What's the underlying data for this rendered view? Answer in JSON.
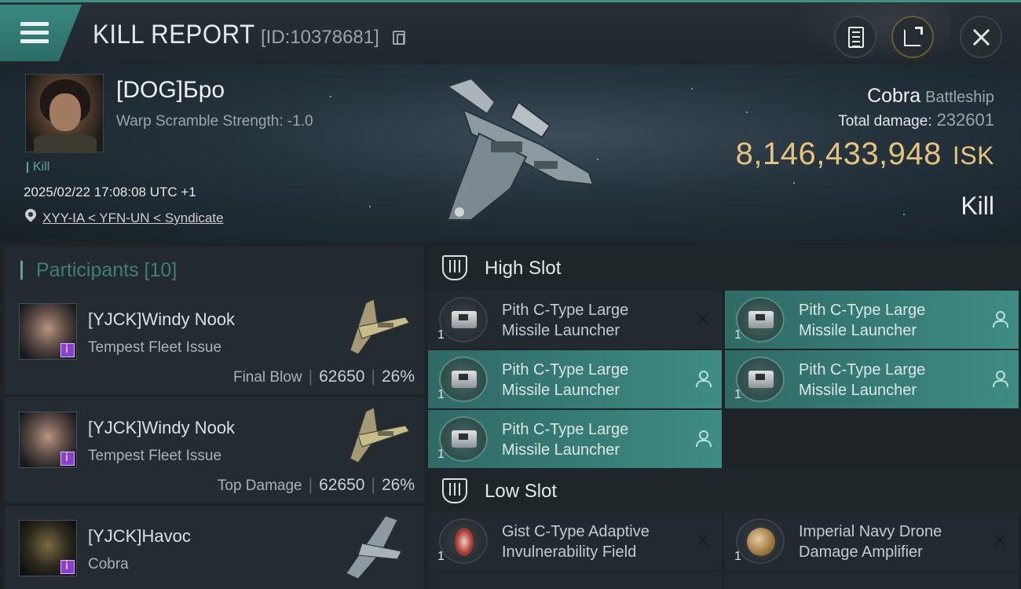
{
  "header": {
    "title": "KILL REPORT",
    "report_id": "[ID:10378681]",
    "icons": [
      "menu-icon",
      "copy-icon",
      "clipboard-icon",
      "share-icon",
      "close-icon"
    ]
  },
  "victim": {
    "name": "[DOG]Бро",
    "warp_scramble": "Warp Scramble Strength: -1.0",
    "kill_tag": "Kill",
    "datetime": "2025/02/22 17:08:08 UTC +1",
    "location": "XYY-IA < YFN-UN < Syndicate",
    "ship_name": "Cobra",
    "ship_class": "Battleship",
    "total_damage_label": "Total damage:",
    "total_damage": "232601",
    "isk_value": "8,146,433,948",
    "isk_unit": "ISK",
    "result": "Kill"
  },
  "participants": {
    "label": "Participants [10]",
    "rows": [
      {
        "name": "[YJCK]Windy Nook",
        "ship": "Tempest Fleet Issue",
        "role": "Final Blow",
        "damage": "62650",
        "percent": "26%"
      },
      {
        "name": "[YJCK]Windy Nook",
        "ship": "Tempest Fleet Issue",
        "role": "Top Damage",
        "damage": "62650",
        "percent": "26%"
      },
      {
        "name": "[YJCK]Havoc",
        "ship": "Cobra",
        "role": "",
        "damage": "",
        "percent": ""
      }
    ]
  },
  "slots": {
    "high": {
      "label": "High Slot",
      "modules": [
        {
          "name_line1": "Pith C-Type Large",
          "name_line2": "Missile Launcher",
          "qty": "1",
          "status": "destroyed"
        },
        {
          "name_line1": "Pith C-Type Large",
          "name_line2": "Missile Launcher",
          "qty": "1",
          "status": "dropped"
        },
        {
          "name_line1": "Pith C-Type Large",
          "name_line2": "Missile Launcher",
          "qty": "1",
          "status": "dropped"
        },
        {
          "name_line1": "Pith C-Type Large",
          "name_line2": "Missile Launcher",
          "qty": "1",
          "status": "dropped"
        },
        {
          "name_line1": "Pith C-Type Large",
          "name_line2": "Missile Launcher",
          "qty": "1",
          "status": "dropped"
        }
      ]
    },
    "low": {
      "label": "Low Slot",
      "modules": [
        {
          "name_line1": "Gist C-Type Adaptive",
          "name_line2": "Invulnerability Field",
          "qty": "1",
          "status": "destroyed"
        },
        {
          "name_line1": "Imperial Navy Drone",
          "name_line2": "Damage Amplifier",
          "qty": "1",
          "status": "destroyed"
        }
      ]
    }
  },
  "colors": {
    "accent": "#3e8c84",
    "isk": "#e6c37c",
    "background": "#1d2327"
  }
}
